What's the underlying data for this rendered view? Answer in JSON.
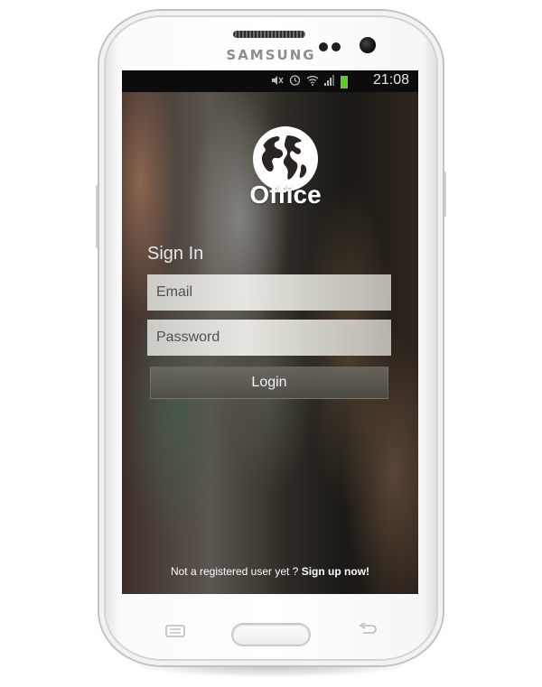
{
  "device": {
    "brand": "SAMSUNG"
  },
  "statusbar": {
    "time": "21:08",
    "icons": [
      "mute-icon",
      "alarm-icon",
      "wifi-icon",
      "signal-icon",
      "battery-icon"
    ]
  },
  "app": {
    "logo": "globe-icon",
    "title": "Office",
    "signin_label": "Sign In",
    "email_placeholder": "Email",
    "password_placeholder": "Password",
    "login_label": "Login",
    "signup_prompt": "Not a registered user yet ?",
    "signup_link": "Sign up now!"
  },
  "navbar": {
    "left": "menu-icon",
    "center": "home-button",
    "right": "back-icon"
  },
  "colors": {
    "battery": "#55d21a"
  }
}
